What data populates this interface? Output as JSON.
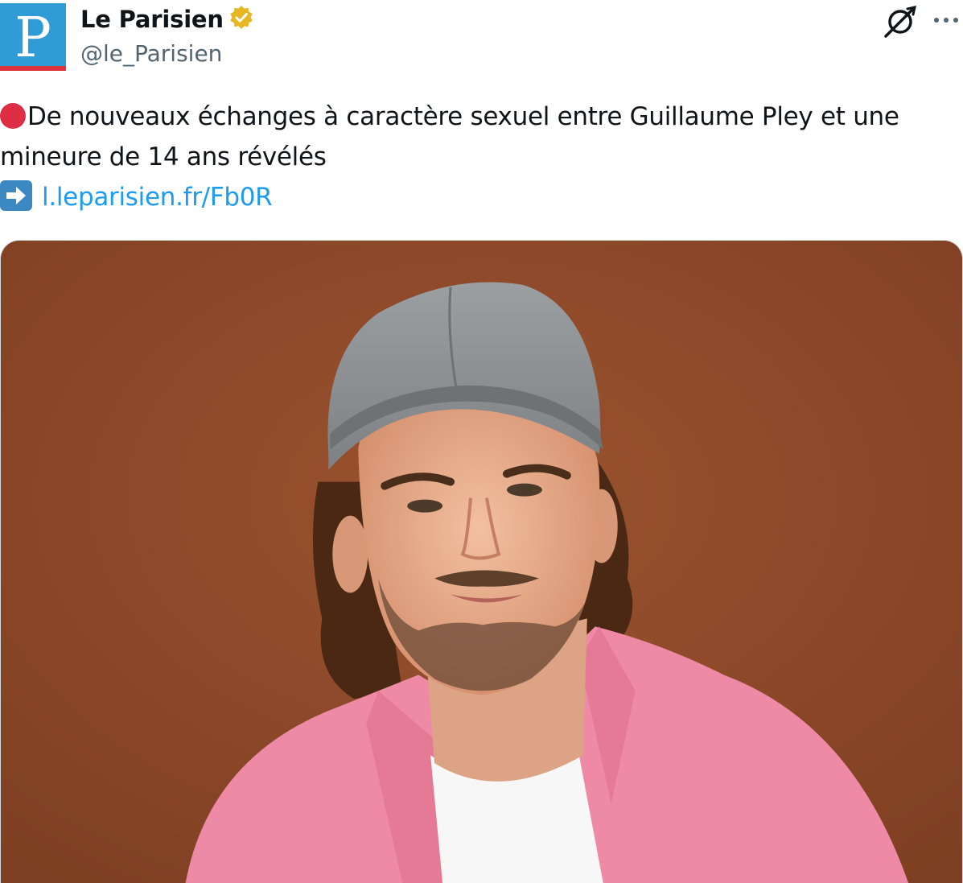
{
  "author": {
    "display_name": "Le Parisien",
    "handle": "@le_Parisien",
    "logo_letter": "P",
    "verified_icon": "verified-badge-icon",
    "colors": {
      "logo_blue": "#2f9bd7",
      "logo_red": "#e0343c",
      "verified": "#e8b623"
    }
  },
  "actions": {
    "grok_icon": "grok-icon",
    "more_icon": "more-options-icon"
  },
  "tweet": {
    "bullet_icon": "red-circle-emoji",
    "line1": "De nouveaux échanges à caractère sexuel entre Guillaume Pley et une",
    "line2": "mineure de 14 ans révélés",
    "arrow_icon": "right-arrow-emoji",
    "link_text": "l.leparisien.fr/Fb0R",
    "colors": {
      "link": "#1d9bf0"
    }
  },
  "media": {
    "type": "photo",
    "colors": {
      "background": "#8e4a2b",
      "cap": "#8d9093",
      "shirt": "#ee8aa6",
      "tshirt": "#f7f7f7"
    }
  }
}
